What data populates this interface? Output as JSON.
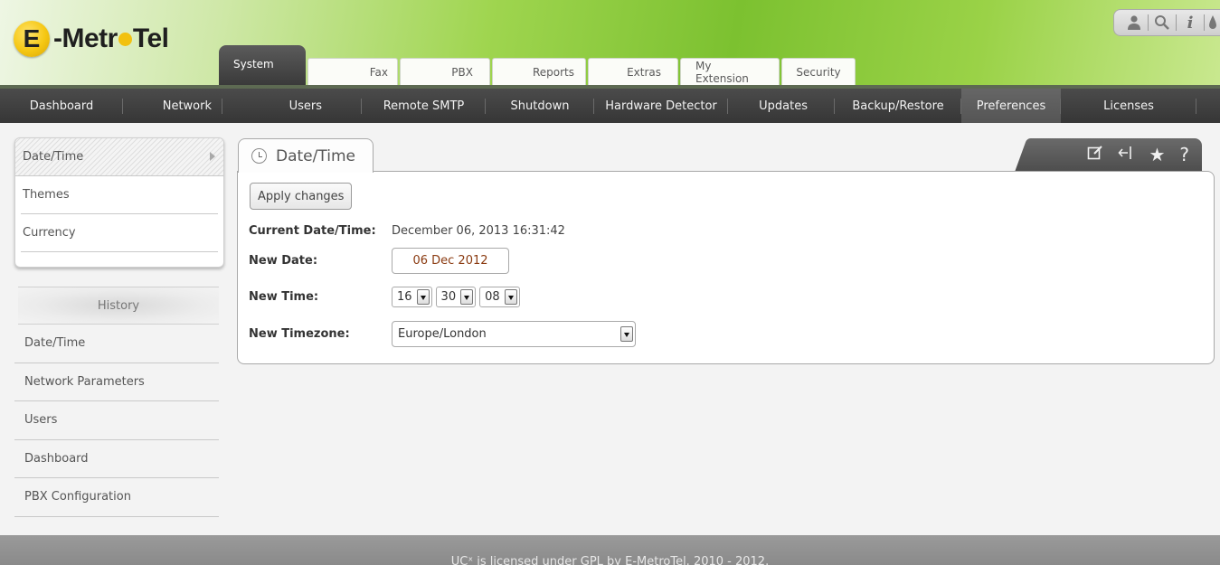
{
  "header": {
    "logo_letter": "E",
    "logo_part1": "-Metr",
    "logo_part2": "Tel",
    "tabs": [
      {
        "label": "System",
        "active": true
      },
      {
        "label": "Fax"
      },
      {
        "label": "PBX"
      },
      {
        "label": "Reports"
      },
      {
        "label": "Extras"
      },
      {
        "label": "My Extension"
      },
      {
        "label": "Security"
      }
    ],
    "util_icons": [
      "user-icon",
      "search-icon",
      "info-icon",
      "drop-icon"
    ]
  },
  "subnav": [
    {
      "label": "Dashboard"
    },
    {
      "label": "Network"
    },
    {
      "label": "Users"
    },
    {
      "label": "Remote SMTP"
    },
    {
      "label": "Shutdown"
    },
    {
      "label": "Hardware Detector"
    },
    {
      "label": "Updates"
    },
    {
      "label": "Backup/Restore"
    },
    {
      "label": "Preferences",
      "active": true
    },
    {
      "label": "Licenses"
    }
  ],
  "sidebar": {
    "items": [
      {
        "label": "Date/Time",
        "active": true
      },
      {
        "label": "Themes"
      },
      {
        "label": "Currency"
      }
    ],
    "history_title": "History",
    "history": [
      {
        "label": "Date/Time"
      },
      {
        "label": "Network Parameters"
      },
      {
        "label": "Users"
      },
      {
        "label": "Dashboard"
      },
      {
        "label": "PBX Configuration"
      }
    ]
  },
  "panel": {
    "title": "Date/Time",
    "tools": [
      "edit-icon",
      "collapse-icon",
      "star-icon",
      "help-icon"
    ],
    "apply_label": "Apply changes",
    "current_label": "Current Date/Time:",
    "current_value": "December 06, 2013 16:31:42",
    "new_date_label": "New Date:",
    "new_date_value": "06 Dec 2012",
    "new_time_label": "New Time:",
    "hour": "16",
    "minute": "30",
    "second": "08",
    "timezone_label": "New Timezone:",
    "timezone_value": "Europe/London"
  },
  "footer": {
    "text": "UCˣ is licensed under GPL by E-MetroTel. 2010 - 2012."
  },
  "colors": {
    "accent_green": "#7cc130",
    "nav_dark": "#3f3f3f",
    "logo_yellow": "#f2c110"
  }
}
